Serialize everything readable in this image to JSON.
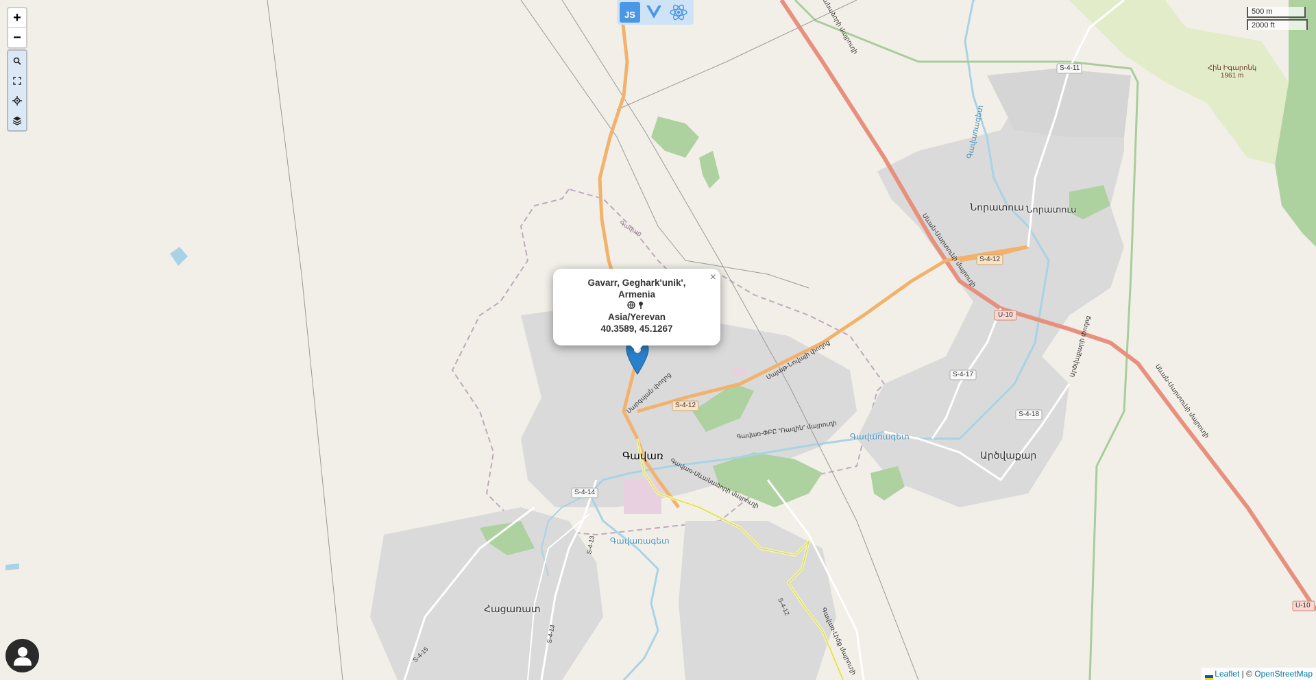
{
  "map": {
    "popup": {
      "place": "Gavarr, Geghark'unik',",
      "country": "Armenia",
      "timezone": "Asia/Yerevan",
      "coords": "40.3589, 45.1267",
      "close": "×"
    },
    "controls": {
      "zoom_in": "+",
      "zoom_out": "−"
    },
    "scale": {
      "metric": "500 m",
      "imperial": "2000 ft"
    },
    "frameworks": {
      "js": "JS"
    },
    "attribution": {
      "leaflet": "Leaflet",
      "separator": " | © ",
      "osm": "OpenStreetMap"
    },
    "labels": {
      "town_main": "Գավառ",
      "town_noratus": "Նորատուս",
      "town_noratus2": "Նորատուս",
      "town_artsvakar": "Արծվաքար",
      "town_hatsarat": "Հացառատ",
      "peak": "Հին Իգարոնկ",
      "peak_elev": "1961 m",
      "river_gavaraget": "Գավառագետ",
      "river_gavaraget2": "Գավառագետ",
      "river_gavaraget3": "Գավառագետ",
      "river_north": "Գավառագետ",
      "road_s411": "S-4-11",
      "road_s412a": "S-4-12",
      "road_s412b": "S-4-12",
      "road_u10a": "U-10",
      "road_u10b": "U-10",
      "road_s417": "S-4-17",
      "road_s418": "S-4-18",
      "road_s414": "S-4-14",
      "road_s413": "S-4-13",
      "road_s413b": "S-4-13",
      "road_s415": "S-4-15",
      "road_s412c": "S-4-12",
      "street1": "Սարգսյան փողոց",
      "street2": "Սայաթ-Նովայի փողոց",
      "street3": "Գավառ-ՓԲԸ \"Ռազին\" մայրուղի",
      "street4": "Գավառ-Սևանաձորի մայրուղի",
      "street5": "Սևան-Մարտունի մայրուղի",
      "street6": "Գավառ-Սևանաձորի մայրուղի",
      "street7": "Արծվաքարի փողոց",
      "street8": "Գավառ-Լիճք մայրուղի",
      "street9": "Սևան-Մարտունի մայրուղի",
      "region": "Գավառ"
    },
    "colors": {
      "background": "#f2efe9",
      "urban": "#dadada",
      "primary_road": "#f3b26b",
      "trunk_road": "#e8907e",
      "secondary_road": "#f7f6a4",
      "water": "#a8d3e6",
      "forest": "#aed1a0",
      "marker": "#2a81cb",
      "boundary": "#a68ba6"
    }
  }
}
